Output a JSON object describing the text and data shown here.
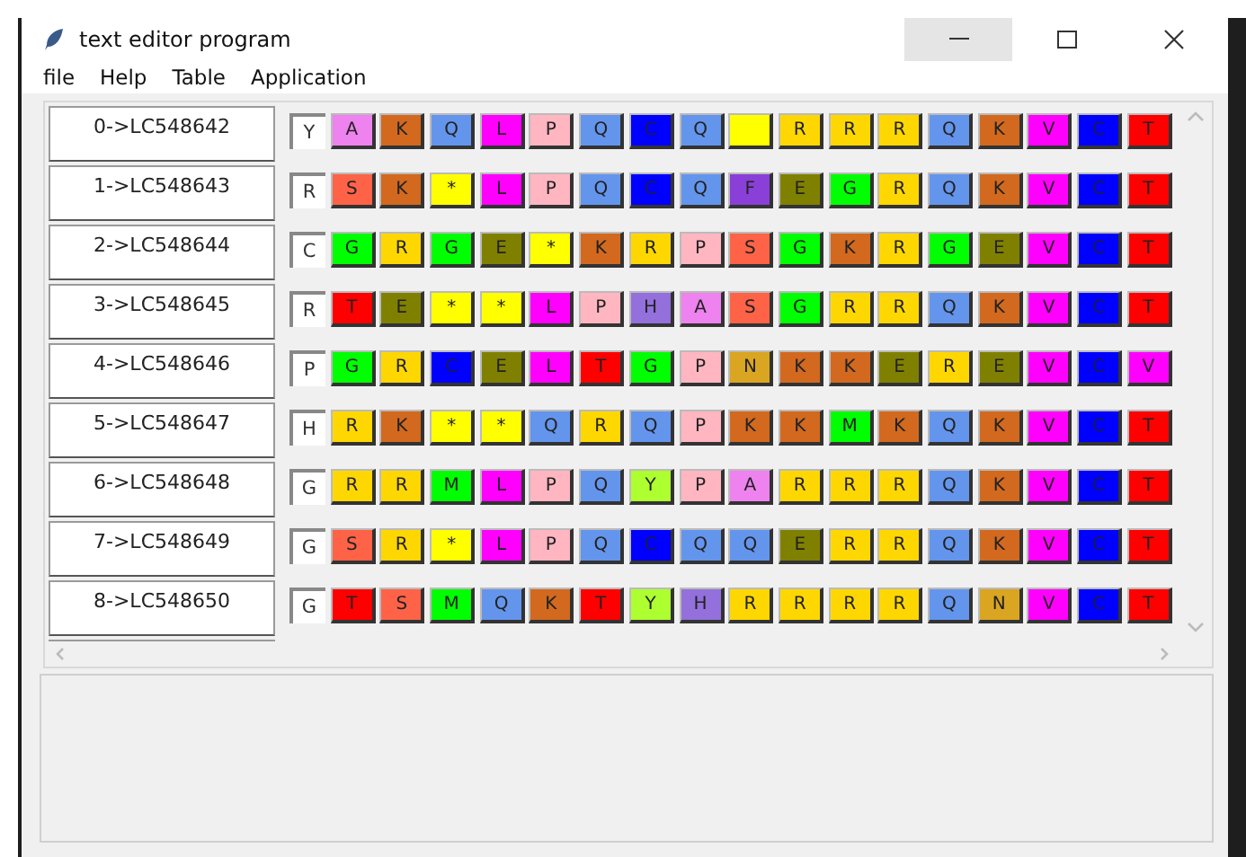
{
  "window": {
    "title": "text editor program"
  },
  "menu": [
    "file",
    "Help",
    "Table",
    "Application"
  ],
  "rows": [
    {
      "label": "0->LC548642",
      "first": "Y",
      "cells": [
        {
          "text": "A",
          "color": "#ee82ee"
        },
        {
          "text": "K",
          "color": "#d2691e"
        },
        {
          "text": "Q",
          "color": "#6495ed"
        },
        {
          "text": "L",
          "color": "#ff00ff"
        },
        {
          "text": "P",
          "color": "#ffb6c1"
        },
        {
          "text": "Q",
          "color": "#6495ed"
        },
        {
          "text": "C",
          "color": "#0000ff"
        },
        {
          "text": "Q",
          "color": "#6495ed"
        },
        {
          "color": "#ffff00"
        },
        {
          "text": "R",
          "color": "#ffd700"
        },
        {
          "text": "R",
          "color": "#ffd700"
        },
        {
          "text": "R",
          "color": "#ffd700"
        },
        {
          "text": "Q",
          "color": "#6495ed"
        },
        {
          "text": "K",
          "color": "#d2691e"
        },
        {
          "text": "V",
          "color": "#ff00ff"
        },
        {
          "text": "C",
          "color": "#0000ff"
        },
        {
          "text": "T",
          "color": "#ff0000"
        }
      ]
    },
    {
      "label": "1->LC548643",
      "first": "R",
      "cells": [
        {
          "text": "S",
          "color": "#ff6347"
        },
        {
          "text": "K",
          "color": "#d2691e"
        },
        {
          "text": "*",
          "color": "#ffff00"
        },
        {
          "text": "L",
          "color": "#ff00ff"
        },
        {
          "text": "P",
          "color": "#ffb6c1"
        },
        {
          "text": "Q",
          "color": "#6495ed"
        },
        {
          "text": "C",
          "color": "#0000ff"
        },
        {
          "text": "Q",
          "color": "#6495ed"
        },
        {
          "text": "F",
          "color": "#8a3fd8"
        },
        {
          "text": "E",
          "color": "#808000"
        },
        {
          "text": "G",
          "color": "#00ff00"
        },
        {
          "text": "R",
          "color": "#ffd700"
        },
        {
          "text": "Q",
          "color": "#6495ed"
        },
        {
          "text": "K",
          "color": "#d2691e"
        },
        {
          "text": "V",
          "color": "#ff00ff"
        },
        {
          "text": "C",
          "color": "#0000ff"
        },
        {
          "text": "T",
          "color": "#ff0000"
        }
      ]
    },
    {
      "label": "2->LC548644",
      "first": "C",
      "cells": [
        {
          "text": "G",
          "color": "#00ff00"
        },
        {
          "text": "R",
          "color": "#ffd700"
        },
        {
          "text": "G",
          "color": "#00ff00"
        },
        {
          "text": "E",
          "color": "#808000"
        },
        {
          "text": "*",
          "color": "#ffff00"
        },
        {
          "text": "K",
          "color": "#d2691e"
        },
        {
          "text": "R",
          "color": "#ffd700"
        },
        {
          "text": "P",
          "color": "#ffb6c1"
        },
        {
          "text": "S",
          "color": "#ff6347"
        },
        {
          "text": "G",
          "color": "#00ff00"
        },
        {
          "text": "K",
          "color": "#d2691e"
        },
        {
          "text": "R",
          "color": "#ffd700"
        },
        {
          "text": "G",
          "color": "#00ff00"
        },
        {
          "text": "E",
          "color": "#808000"
        },
        {
          "text": "V",
          "color": "#ff00ff"
        },
        {
          "text": "C",
          "color": "#0000ff"
        },
        {
          "text": "T",
          "color": "#ff0000"
        }
      ]
    },
    {
      "label": "3->LC548645",
      "first": "R",
      "cells": [
        {
          "text": "T",
          "color": "#ff0000"
        },
        {
          "text": "E",
          "color": "#808000"
        },
        {
          "text": "*",
          "color": "#ffff00"
        },
        {
          "text": "*",
          "color": "#ffff00"
        },
        {
          "text": "L",
          "color": "#ff00ff"
        },
        {
          "text": "P",
          "color": "#ffb6c1"
        },
        {
          "text": "H",
          "color": "#9370db"
        },
        {
          "text": "A",
          "color": "#ee82ee"
        },
        {
          "text": "S",
          "color": "#ff6347"
        },
        {
          "text": "G",
          "color": "#00ff00"
        },
        {
          "text": "R",
          "color": "#ffd700"
        },
        {
          "text": "R",
          "color": "#ffd700"
        },
        {
          "text": "Q",
          "color": "#6495ed"
        },
        {
          "text": "K",
          "color": "#d2691e"
        },
        {
          "text": "V",
          "color": "#ff00ff"
        },
        {
          "text": "C",
          "color": "#0000ff"
        },
        {
          "text": "T",
          "color": "#ff0000"
        }
      ]
    },
    {
      "label": "4->LC548646",
      "first": "P",
      "cells": [
        {
          "text": "G",
          "color": "#00ff00"
        },
        {
          "text": "R",
          "color": "#ffd700"
        },
        {
          "text": "C",
          "color": "#0000ff"
        },
        {
          "text": "E",
          "color": "#808000"
        },
        {
          "text": "L",
          "color": "#ff00ff"
        },
        {
          "text": "T",
          "color": "#ff0000"
        },
        {
          "text": "G",
          "color": "#00ff00"
        },
        {
          "text": "P",
          "color": "#ffb6c1"
        },
        {
          "text": "N",
          "color": "#daa520"
        },
        {
          "text": "K",
          "color": "#d2691e"
        },
        {
          "text": "K",
          "color": "#d2691e"
        },
        {
          "text": "E",
          "color": "#808000"
        },
        {
          "text": "R",
          "color": "#ffd700"
        },
        {
          "text": "E",
          "color": "#808000"
        },
        {
          "text": "V",
          "color": "#ff00ff"
        },
        {
          "text": "C",
          "color": "#0000ff"
        },
        {
          "text": "V",
          "color": "#ff00ff"
        }
      ]
    },
    {
      "label": "5->LC548647",
      "first": "H",
      "cells": [
        {
          "text": "R",
          "color": "#ffd700"
        },
        {
          "text": "K",
          "color": "#d2691e"
        },
        {
          "text": "*",
          "color": "#ffff00"
        },
        {
          "text": "*",
          "color": "#ffff00"
        },
        {
          "text": "Q",
          "color": "#6495ed"
        },
        {
          "text": "R",
          "color": "#ffd700"
        },
        {
          "text": "Q",
          "color": "#6495ed"
        },
        {
          "text": "P",
          "color": "#ffb6c1"
        },
        {
          "text": "K",
          "color": "#d2691e"
        },
        {
          "text": "K",
          "color": "#d2691e"
        },
        {
          "text": "M",
          "color": "#00ff00"
        },
        {
          "text": "K",
          "color": "#d2691e"
        },
        {
          "text": "Q",
          "color": "#6495ed"
        },
        {
          "text": "K",
          "color": "#d2691e"
        },
        {
          "text": "V",
          "color": "#ff00ff"
        },
        {
          "text": "C",
          "color": "#0000ff"
        },
        {
          "text": "T",
          "color": "#ff0000"
        }
      ]
    },
    {
      "label": "6->LC548648",
      "first": "G",
      "cells": [
        {
          "text": "R",
          "color": "#ffd700"
        },
        {
          "text": "R",
          "color": "#ffd700"
        },
        {
          "text": "M",
          "color": "#00ff00"
        },
        {
          "text": "L",
          "color": "#ff00ff"
        },
        {
          "text": "P",
          "color": "#ffb6c1"
        },
        {
          "text": "Q",
          "color": "#6495ed"
        },
        {
          "text": "Y",
          "color": "#adff2f"
        },
        {
          "text": "P",
          "color": "#ffb6c1"
        },
        {
          "text": "A",
          "color": "#ee82ee"
        },
        {
          "text": "R",
          "color": "#ffd700"
        },
        {
          "text": "R",
          "color": "#ffd700"
        },
        {
          "text": "R",
          "color": "#ffd700"
        },
        {
          "text": "Q",
          "color": "#6495ed"
        },
        {
          "text": "K",
          "color": "#d2691e"
        },
        {
          "text": "V",
          "color": "#ff00ff"
        },
        {
          "text": "C",
          "color": "#0000ff"
        },
        {
          "text": "T",
          "color": "#ff0000"
        }
      ]
    },
    {
      "label": "7->LC548649",
      "first": "G",
      "cells": [
        {
          "text": "S",
          "color": "#ff6347"
        },
        {
          "text": "R",
          "color": "#ffd700"
        },
        {
          "text": "*",
          "color": "#ffff00"
        },
        {
          "text": "L",
          "color": "#ff00ff"
        },
        {
          "text": "P",
          "color": "#ffb6c1"
        },
        {
          "text": "Q",
          "color": "#6495ed"
        },
        {
          "text": "C",
          "color": "#0000ff"
        },
        {
          "text": "Q",
          "color": "#6495ed"
        },
        {
          "text": "Q",
          "color": "#6495ed"
        },
        {
          "text": "E",
          "color": "#808000"
        },
        {
          "text": "R",
          "color": "#ffd700"
        },
        {
          "text": "R",
          "color": "#ffd700"
        },
        {
          "text": "Q",
          "color": "#6495ed"
        },
        {
          "text": "K",
          "color": "#d2691e"
        },
        {
          "text": "V",
          "color": "#ff00ff"
        },
        {
          "text": "C",
          "color": "#0000ff"
        },
        {
          "text": "T",
          "color": "#ff0000"
        }
      ]
    },
    {
      "label": "8->LC548650",
      "first": "G",
      "cells": [
        {
          "text": "T",
          "color": "#ff0000"
        },
        {
          "text": "S",
          "color": "#ff6347"
        },
        {
          "text": "M",
          "color": "#00ff00"
        },
        {
          "text": "Q",
          "color": "#6495ed"
        },
        {
          "text": "K",
          "color": "#d2691e"
        },
        {
          "text": "T",
          "color": "#ff0000"
        },
        {
          "text": "Y",
          "color": "#adff2f"
        },
        {
          "text": "H",
          "color": "#9370db"
        },
        {
          "text": "R",
          "color": "#ffd700"
        },
        {
          "text": "R",
          "color": "#ffd700"
        },
        {
          "text": "R",
          "color": "#ffd700"
        },
        {
          "text": "R",
          "color": "#ffd700"
        },
        {
          "text": "Q",
          "color": "#6495ed"
        },
        {
          "text": "N",
          "color": "#daa520"
        },
        {
          "text": "V",
          "color": "#ff00ff"
        },
        {
          "text": "C",
          "color": "#0000ff"
        },
        {
          "text": "T",
          "color": "#ff0000"
        }
      ]
    }
  ]
}
